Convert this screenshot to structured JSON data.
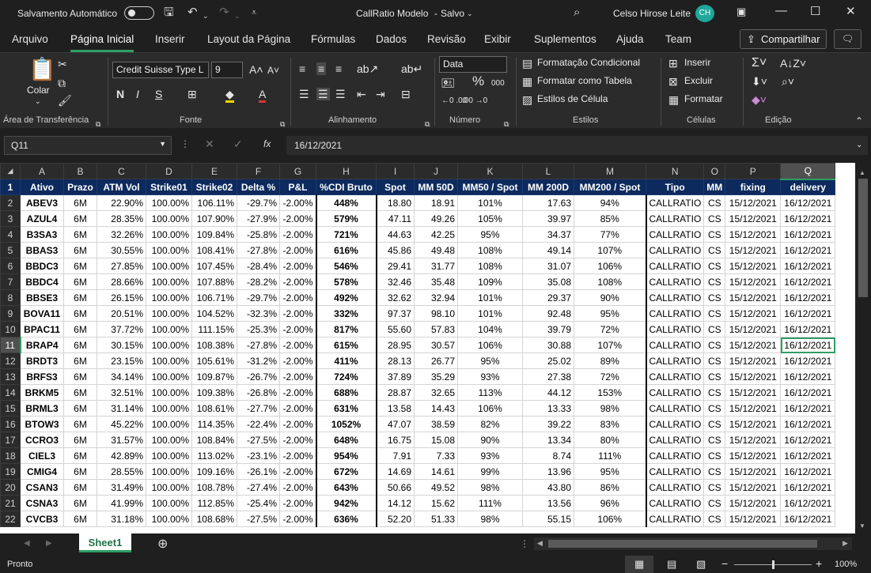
{
  "titlebar": {
    "autosave_label": "Salvamento Automático",
    "doc_title": "CallRatio Modelo",
    "doc_status": "Salvo",
    "user_name": "Celso Hirose Leite",
    "user_initials": "CH"
  },
  "menu": {
    "tabs": [
      "Arquivo",
      "Página Inicial",
      "Inserir",
      "Layout da Página",
      "Fórmulas",
      "Dados",
      "Revisão",
      "Exibir",
      "Suplementos",
      "Ajuda",
      "Team"
    ],
    "share_label": "Compartilhar"
  },
  "ribbon": {
    "paste_label": "Colar",
    "font_name": "Credit Suisse Type L",
    "font_size": "9",
    "number_format": "Data",
    "cond_format": "Formatação Condicional",
    "format_table": "Formatar como Tabela",
    "cell_styles": "Estilos de Célula",
    "insert": "Inserir",
    "delete": "Excluir",
    "format": "Formatar",
    "groups": {
      "clipboard": "Área de Transferência",
      "font": "Fonte",
      "alignment": "Alinhamento",
      "number": "Número",
      "styles": "Estilos",
      "cells": "Células",
      "editing": "Edição"
    }
  },
  "formula_bar": {
    "name_box": "Q11",
    "fx": "fx",
    "content": "16/12/2021"
  },
  "grid": {
    "columns": [
      "A",
      "B",
      "C",
      "D",
      "E",
      "F",
      "G",
      "H",
      "I",
      "J",
      "K",
      "L",
      "M",
      "N",
      "O",
      "P",
      "Q"
    ],
    "header": [
      "Ativo",
      "Prazo",
      "ATM Vol",
      "Strike01",
      "Strike02",
      "Delta %",
      "P&L",
      "%CDI Bruto",
      "Spot",
      "MM 50D",
      "MM50 / Spot",
      "MM 200D",
      "MM200 / Spot",
      "Tipo",
      "MM",
      "fixing",
      "delivery"
    ],
    "rows": [
      [
        "ABEV3",
        "6M",
        "22.90%",
        "100.00%",
        "106.11%",
        "-29.7%",
        "-2.00%",
        "448%",
        "18.80",
        "18.91",
        "101%",
        "17.63",
        "94%",
        "CALLRATIO",
        "CS",
        "15/12/2021",
        "16/12/2021"
      ],
      [
        "AZUL4",
        "6M",
        "28.35%",
        "100.00%",
        "107.90%",
        "-27.9%",
        "-2.00%",
        "579%",
        "47.11",
        "49.26",
        "105%",
        "39.97",
        "85%",
        "CALLRATIO",
        "CS",
        "15/12/2021",
        "16/12/2021"
      ],
      [
        "B3SA3",
        "6M",
        "32.26%",
        "100.00%",
        "109.84%",
        "-25.8%",
        "-2.00%",
        "721%",
        "44.63",
        "42.25",
        "95%",
        "34.37",
        "77%",
        "CALLRATIO",
        "CS",
        "15/12/2021",
        "16/12/2021"
      ],
      [
        "BBAS3",
        "6M",
        "30.55%",
        "100.00%",
        "108.41%",
        "-27.8%",
        "-2.00%",
        "616%",
        "45.86",
        "49.48",
        "108%",
        "49.14",
        "107%",
        "CALLRATIO",
        "CS",
        "15/12/2021",
        "16/12/2021"
      ],
      [
        "BBDC3",
        "6M",
        "27.85%",
        "100.00%",
        "107.45%",
        "-28.4%",
        "-2.00%",
        "546%",
        "29.41",
        "31.77",
        "108%",
        "31.07",
        "106%",
        "CALLRATIO",
        "CS",
        "15/12/2021",
        "16/12/2021"
      ],
      [
        "BBDC4",
        "6M",
        "28.66%",
        "100.00%",
        "107.88%",
        "-28.2%",
        "-2.00%",
        "578%",
        "32.46",
        "35.48",
        "109%",
        "35.08",
        "108%",
        "CALLRATIO",
        "CS",
        "15/12/2021",
        "16/12/2021"
      ],
      [
        "BBSE3",
        "6M",
        "26.15%",
        "100.00%",
        "106.71%",
        "-29.7%",
        "-2.00%",
        "492%",
        "32.62",
        "32.94",
        "101%",
        "29.37",
        "90%",
        "CALLRATIO",
        "CS",
        "15/12/2021",
        "16/12/2021"
      ],
      [
        "BOVA11",
        "6M",
        "20.51%",
        "100.00%",
        "104.52%",
        "-32.3%",
        "-2.00%",
        "332%",
        "97.37",
        "98.10",
        "101%",
        "92.48",
        "95%",
        "CALLRATIO",
        "CS",
        "15/12/2021",
        "16/12/2021"
      ],
      [
        "BPAC11",
        "6M",
        "37.72%",
        "100.00%",
        "111.15%",
        "-25.3%",
        "-2.00%",
        "817%",
        "55.60",
        "57.83",
        "104%",
        "39.79",
        "72%",
        "CALLRATIO",
        "CS",
        "15/12/2021",
        "16/12/2021"
      ],
      [
        "BRAP4",
        "6M",
        "30.15%",
        "100.00%",
        "108.38%",
        "-27.8%",
        "-2.00%",
        "615%",
        "28.95",
        "30.57",
        "106%",
        "30.88",
        "107%",
        "CALLRATIO",
        "CS",
        "15/12/2021",
        "16/12/2021"
      ],
      [
        "BRDT3",
        "6M",
        "23.15%",
        "100.00%",
        "105.61%",
        "-31.2%",
        "-2.00%",
        "411%",
        "28.13",
        "26.77",
        "95%",
        "25.02",
        "89%",
        "CALLRATIO",
        "CS",
        "15/12/2021",
        "16/12/2021"
      ],
      [
        "BRFS3",
        "6M",
        "34.14%",
        "100.00%",
        "109.87%",
        "-26.7%",
        "-2.00%",
        "724%",
        "37.89",
        "35.29",
        "93%",
        "27.38",
        "72%",
        "CALLRATIO",
        "CS",
        "15/12/2021",
        "16/12/2021"
      ],
      [
        "BRKM5",
        "6M",
        "32.51%",
        "100.00%",
        "109.38%",
        "-26.8%",
        "-2.00%",
        "688%",
        "28.87",
        "32.65",
        "113%",
        "44.12",
        "153%",
        "CALLRATIO",
        "CS",
        "15/12/2021",
        "16/12/2021"
      ],
      [
        "BRML3",
        "6M",
        "31.14%",
        "100.00%",
        "108.61%",
        "-27.7%",
        "-2.00%",
        "631%",
        "13.58",
        "14.43",
        "106%",
        "13.33",
        "98%",
        "CALLRATIO",
        "CS",
        "15/12/2021",
        "16/12/2021"
      ],
      [
        "BTOW3",
        "6M",
        "45.22%",
        "100.00%",
        "114.35%",
        "-22.4%",
        "-2.00%",
        "1052%",
        "47.07",
        "38.59",
        "82%",
        "39.22",
        "83%",
        "CALLRATIO",
        "CS",
        "15/12/2021",
        "16/12/2021"
      ],
      [
        "CCRO3",
        "6M",
        "31.57%",
        "100.00%",
        "108.84%",
        "-27.5%",
        "-2.00%",
        "648%",
        "16.75",
        "15.08",
        "90%",
        "13.34",
        "80%",
        "CALLRATIO",
        "CS",
        "15/12/2021",
        "16/12/2021"
      ],
      [
        "CIEL3",
        "6M",
        "42.89%",
        "100.00%",
        "113.02%",
        "-23.1%",
        "-2.00%",
        "954%",
        "7.91",
        "7.33",
        "93%",
        "8.74",
        "111%",
        "CALLRATIO",
        "CS",
        "15/12/2021",
        "16/12/2021"
      ],
      [
        "CMIG4",
        "6M",
        "28.55%",
        "100.00%",
        "109.16%",
        "-26.1%",
        "-2.00%",
        "672%",
        "14.69",
        "14.61",
        "99%",
        "13.96",
        "95%",
        "CALLRATIO",
        "CS",
        "15/12/2021",
        "16/12/2021"
      ],
      [
        "CSAN3",
        "6M",
        "31.49%",
        "100.00%",
        "108.78%",
        "-27.4%",
        "-2.00%",
        "643%",
        "50.66",
        "49.52",
        "98%",
        "43.80",
        "86%",
        "CALLRATIO",
        "CS",
        "15/12/2021",
        "16/12/2021"
      ],
      [
        "CSNA3",
        "6M",
        "41.99%",
        "100.00%",
        "112.85%",
        "-25.4%",
        "-2.00%",
        "942%",
        "14.12",
        "15.62",
        "111%",
        "13.56",
        "96%",
        "CALLRATIO",
        "CS",
        "15/12/2021",
        "16/12/2021"
      ],
      [
        "CVCB3",
        "6M",
        "31.18%",
        "100.00%",
        "108.68%",
        "-27.5%",
        "-2.00%",
        "636%",
        "52.20",
        "51.33",
        "98%",
        "55.15",
        "106%",
        "CALLRATIO",
        "CS",
        "15/12/2021",
        "16/12/2021"
      ]
    ],
    "selected_row": 11,
    "selected_col": "Q"
  },
  "sheets": [
    "Sheet1"
  ],
  "status": {
    "ready": "Pronto",
    "zoom": "100%"
  }
}
